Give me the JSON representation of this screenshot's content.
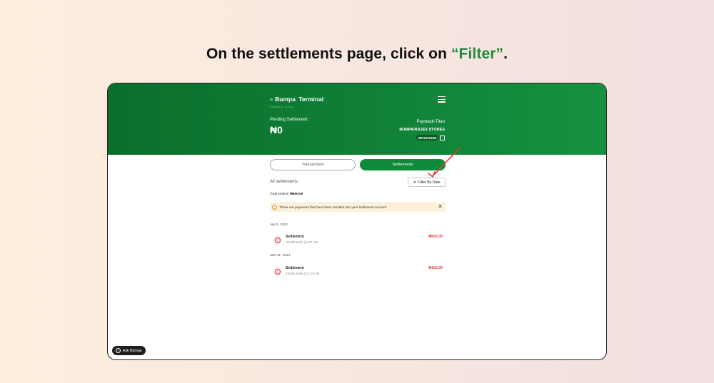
{
  "instruction": {
    "prefix": "On the settlements page, click on ",
    "highlight": "“Filter”",
    "suffix": "."
  },
  "header": {
    "brand": "Bumpa",
    "brand_suffix": "Terminal",
    "brand_sub": "Powered by · Bumpa",
    "pending_label": "Pending Settlement:",
    "pending_amount": "₦0",
    "bank": "Paystack-Titan",
    "account_name": "BUMPA/RAJEX STORES",
    "account_number": "9872319158"
  },
  "tabs": [
    {
      "label": "Transactions",
      "active": false
    },
    {
      "label": "Settlements",
      "active": true
    }
  ],
  "section": {
    "title": "All settlements",
    "filter_label": "Filter By Date",
    "total_label": "Total settled:",
    "total_value": "₦650.00"
  },
  "notice": {
    "text": "These are payments that have been remitted into your settlement account",
    "close": "✕"
  },
  "groups": [
    {
      "date": "Apr 9, 2024",
      "items": [
        {
          "title": "Settlement",
          "sub": "Zenith Bank | 8:37 AM",
          "amount": "₦500.00"
        }
      ]
    },
    {
      "date": "Mar 31, 2024",
      "items": [
        {
          "title": "Settlement",
          "sub": "Zenith Bank | 11:23 AM",
          "amount": "₦150.00"
        }
      ]
    }
  ],
  "ask": {
    "label": "Ask Bumpa"
  },
  "colors": {
    "brand_green": "#0f8a3a",
    "accent_green": "#1f8a3c",
    "arrow_red": "#e53935",
    "amount_red": "#e23b3b"
  }
}
